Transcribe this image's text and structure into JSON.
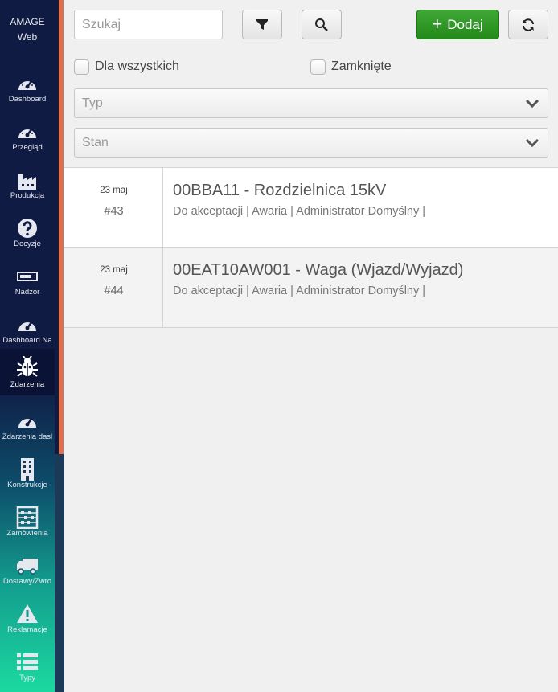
{
  "brand": {
    "line1": "AMAGE",
    "line2": "Web"
  },
  "nav": [
    {
      "label": "Dashboard",
      "icon": "gauge-icon"
    },
    {
      "label": "Przegląd",
      "icon": "gauge-icon"
    },
    {
      "label": "Produkcja",
      "icon": "factory-icon"
    },
    {
      "label": "Decyzje",
      "icon": "question-icon"
    },
    {
      "label": "Nadzór",
      "icon": "battery-icon"
    },
    {
      "label": "Dashboard Na",
      "icon": "gauge-icon"
    },
    {
      "label": "Zdarzenia",
      "icon": "bug-icon",
      "active": true
    },
    {
      "label": "Zdarzenia dasl",
      "icon": "gauge-icon"
    },
    {
      "label": "Konstrukcje",
      "icon": "building-icon"
    },
    {
      "label": "Zamówienia",
      "icon": "abacus-icon"
    },
    {
      "label": "Dostawy/Zwro",
      "icon": "truck-icon"
    },
    {
      "label": "Reklamacje",
      "icon": "warning-icon"
    },
    {
      "label": "Typy",
      "icon": "list-icon"
    }
  ],
  "toolbar": {
    "search_placeholder": "Szukaj",
    "add_label": "Dodaj",
    "filter_icon": "filter-icon",
    "search_icon": "search-icon",
    "refresh_icon": "refresh-icon"
  },
  "filters": {
    "for_all_label": "Dla wszystkich",
    "closed_label": "Zamknięte",
    "type_placeholder": "Typ",
    "state_placeholder": "Stan"
  },
  "events": [
    {
      "date": "23 maj",
      "number": "#43",
      "title": "00BBA11 - Rozdzielnica 15kV",
      "meta": "Do akceptacji | Awaria | Administrator Domyślny |"
    },
    {
      "date": "23 maj",
      "number": "#44",
      "title": "00EAT10AW001 - Waga (Wjazd/Wyjazd)",
      "meta": "Do akceptacji | Awaria | Administrator Domyślny |"
    }
  ],
  "colors": {
    "sidebar": "#101b44",
    "accent": "#e0704a",
    "add_button": "#2e9a24"
  }
}
